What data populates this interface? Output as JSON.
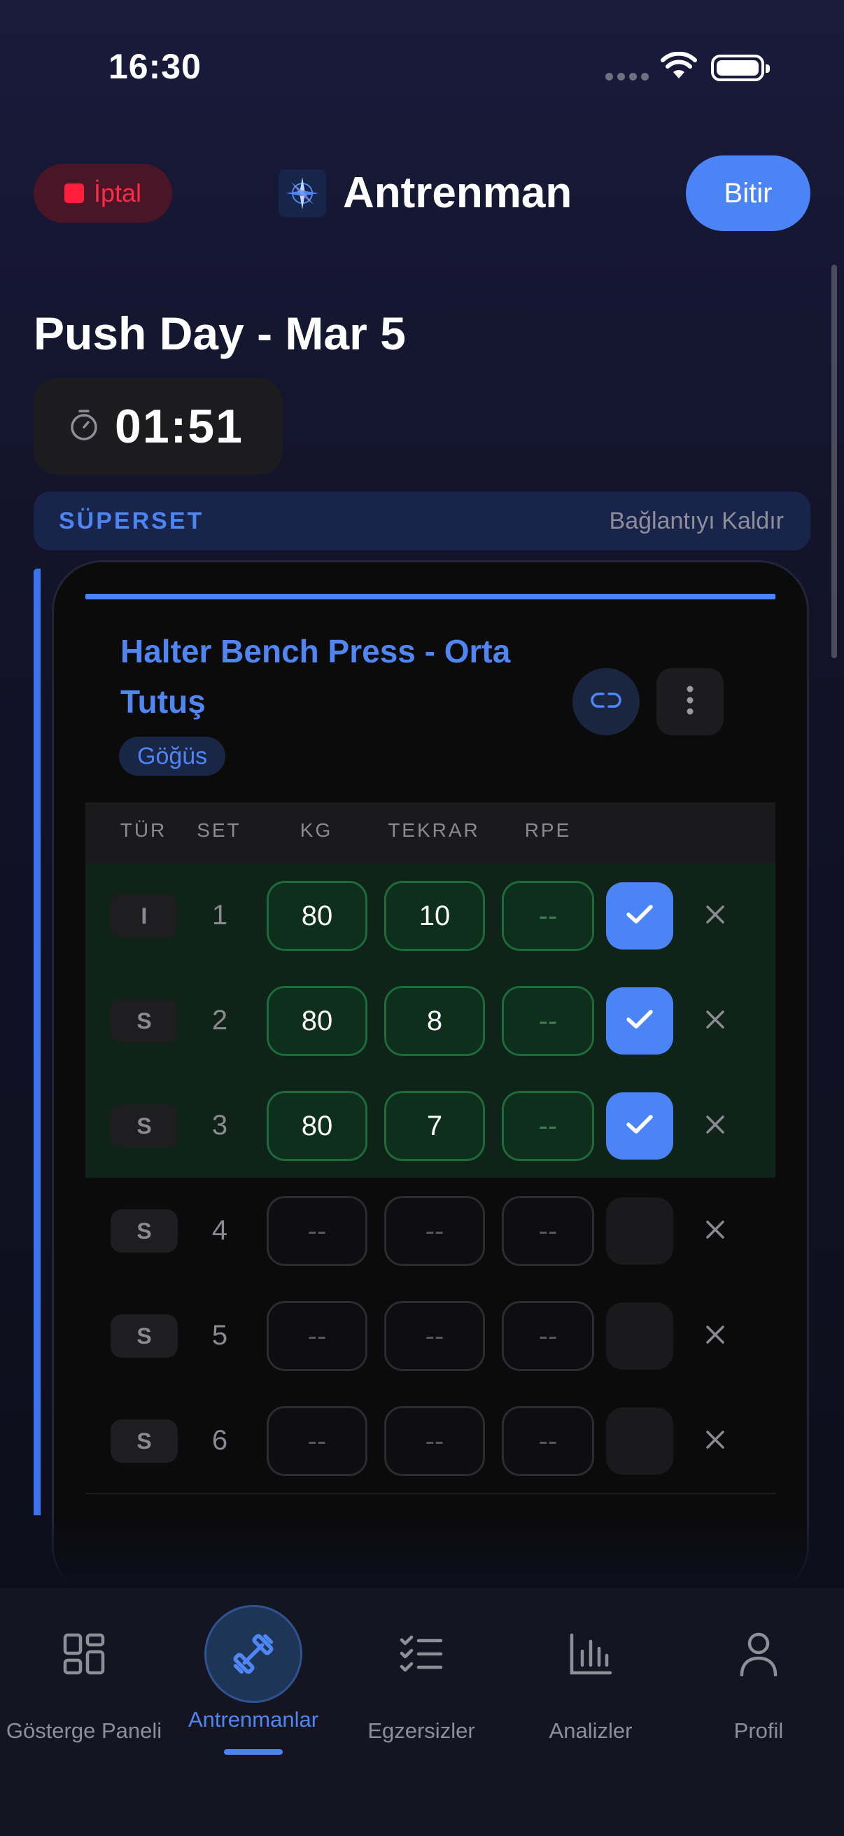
{
  "status_bar": {
    "time": "16:30"
  },
  "header": {
    "cancel_label": "İptal",
    "title": "Antrenman",
    "finish_label": "Bitir"
  },
  "workout": {
    "title": "Push Day - Mar 5",
    "timer": "01:51"
  },
  "superset": {
    "label": "SÜPERSET",
    "unlink_label": "Bağlantıyı Kaldır"
  },
  "exercise": {
    "name": "Halter Bench Press - Orta Tutuş",
    "muscle": "Göğüs",
    "columns": {
      "type": "TÜR",
      "set": "SET",
      "kg": "KG",
      "reps": "TEKRAR",
      "rpe": "RPE"
    },
    "sets": [
      {
        "type": "I",
        "set": "1",
        "kg": "80",
        "reps": "10",
        "rpe": "--",
        "done": true
      },
      {
        "type": "S",
        "set": "2",
        "kg": "80",
        "reps": "8",
        "rpe": "--",
        "done": true
      },
      {
        "type": "S",
        "set": "3",
        "kg": "80",
        "reps": "7",
        "rpe": "--",
        "done": true
      },
      {
        "type": "S",
        "set": "4",
        "kg": "--",
        "reps": "--",
        "rpe": "--",
        "done": false
      },
      {
        "type": "S",
        "set": "5",
        "kg": "--",
        "reps": "--",
        "rpe": "--",
        "done": false
      },
      {
        "type": "S",
        "set": "6",
        "kg": "--",
        "reps": "--",
        "rpe": "--",
        "done": false
      }
    ]
  },
  "nav": {
    "items": [
      {
        "label": "Gösterge Paneli",
        "icon": "dashboard-icon"
      },
      {
        "label": "Antrenmanlar",
        "icon": "dumbbell-icon",
        "active": true
      },
      {
        "label": "Egzersizler",
        "icon": "checklist-icon"
      },
      {
        "label": "Analizler",
        "icon": "bar-chart-icon"
      },
      {
        "label": "Profil",
        "icon": "person-icon"
      }
    ]
  },
  "colors": {
    "accent": "#4a84f6",
    "danger": "#ff1f3d",
    "success_bg": "#0d2f1b"
  }
}
